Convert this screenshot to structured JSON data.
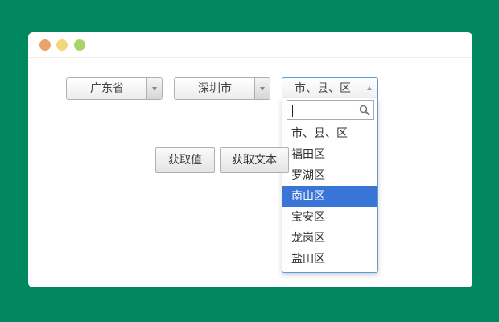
{
  "colors": {
    "background": "#008760",
    "window": "#ffffff",
    "dot_red": "#e9a26a",
    "dot_yellow": "#f4d67c",
    "dot_green": "#a8d46b",
    "highlight": "#3875d7",
    "focus_border": "#5b9ad6"
  },
  "selects": {
    "province": {
      "value": "广东省"
    },
    "city": {
      "value": "深圳市"
    },
    "district": {
      "value": "市、县、区",
      "search_value": "",
      "options": [
        "市、县、区",
        "福田区",
        "罗湖区",
        "南山区",
        "宝安区",
        "龙岗区",
        "盐田区"
      ],
      "highlighted": "南山区"
    }
  },
  "buttons": {
    "get_value": "获取值",
    "get_text": "获取文本"
  },
  "icons": {
    "search": "search-icon",
    "dropdown_arrow": "chevron-down-icon",
    "dropdown_arrow_up": "chevron-up-icon"
  }
}
